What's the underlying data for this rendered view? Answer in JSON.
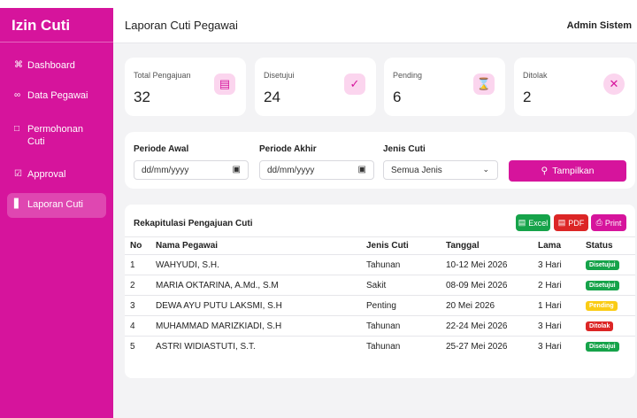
{
  "app": {
    "brand": "Izin Cuti",
    "page_title": "Laporan Cuti Pegawai",
    "user": "Admin Sistem"
  },
  "sidebar": {
    "items": [
      {
        "label": "Dashboard",
        "icon": "grid-icon"
      },
      {
        "label": "Data Pegawai",
        "icon": "users-icon"
      },
      {
        "label": "Permohonan Cuti",
        "icon": "file-icon"
      },
      {
        "label": "Approval",
        "icon": "check-square-icon"
      },
      {
        "label": "Laporan Cuti",
        "icon": "bar-chart-icon",
        "active": true
      }
    ]
  },
  "stats": [
    {
      "label": "Total Pengajuan",
      "value": "32",
      "icon": "document-icon"
    },
    {
      "label": "Disetujui",
      "value": "24",
      "icon": "check-circle-icon"
    },
    {
      "label": "Pending",
      "value": "6",
      "icon": "hourglass-icon"
    },
    {
      "label": "Ditolak",
      "value": "2",
      "icon": "x-circle-icon"
    }
  ],
  "filter": {
    "start_label": "Periode Awal",
    "start_placeholder": "dd/mm/yyyy",
    "end_label": "Periode Akhir",
    "end_placeholder": "dd/mm/yyyy",
    "type_label": "Jenis Cuti",
    "type_selected": "Semua Jenis",
    "submit_label": "Tampilkan"
  },
  "report": {
    "title": "Rekapitulasi Pengajuan Cuti",
    "export": {
      "excel": "Excel",
      "pdf": "PDF",
      "print": "Print"
    },
    "columns": [
      "No",
      "Nama Pegawai",
      "Jenis Cuti",
      "Tanggal",
      "Lama",
      "Status"
    ],
    "rows": [
      {
        "no": "1",
        "nama": "WAHYUDI, S.H.",
        "jenis": "Tahunan",
        "tanggal": "10-12 Mei 2026",
        "lama": "3 Hari",
        "status": "Disetujui"
      },
      {
        "no": "2",
        "nama": "MARIA OKTARINA, A.Md., S.M",
        "jenis": "Sakit",
        "tanggal": "08-09 Mei 2026",
        "lama": "2 Hari",
        "status": "Disetujui"
      },
      {
        "no": "3",
        "nama": "DEWA AYU PUTU LAKSMI, S.H",
        "jenis": "Penting",
        "tanggal": "20 Mei 2026",
        "lama": "1 Hari",
        "status": "Pending"
      },
      {
        "no": "4",
        "nama": "MUHAMMAD MARIZKIADI, S.H",
        "jenis": "Tahunan",
        "tanggal": "22-24 Mei 2026",
        "lama": "3 Hari",
        "status": "Ditolak"
      },
      {
        "no": "5",
        "nama": "ASTRI WIDIASTUTI, S.T.",
        "jenis": "Tahunan",
        "tanggal": "25-27 Mei 2026",
        "lama": "3 Hari",
        "status": "Disetujui"
      }
    ]
  },
  "colors": {
    "brand": "#d6149c",
    "approved": "#16a34a",
    "pending": "#facc15",
    "rejected": "#dc2626"
  }
}
